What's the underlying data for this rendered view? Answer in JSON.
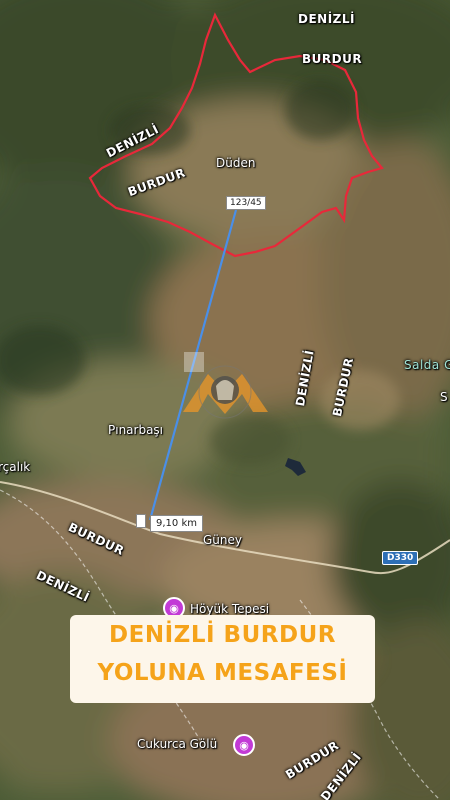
{
  "map": {
    "labels": {
      "denizli_top": "DENİZLİ",
      "burdur_top": "BURDUR",
      "denizli_left": "DENİZLİ",
      "burdur_left": "BURDUR",
      "duden": "Düden",
      "denizli_mid": "DENİZLİ",
      "burdur_mid": "BURDUR",
      "salda": "Salda G",
      "salda_s": "S",
      "pinarbasi": "Pınarbaşı",
      "calik": "rçalık",
      "burdur_lower": "BURDUR",
      "denizli_lower": "DENİZLİ",
      "guney": "Güney",
      "hoyuk": "Höyük Tepesi",
      "cukurca": "Cukurca Gölü",
      "burdur_bottom": "BURDUR",
      "denizli_bottom": "DENİZLİ"
    },
    "parcel_label": "123/45",
    "distance_label": "9,10 km",
    "road_shield": "D330",
    "colors": {
      "boundary": "#e8283a",
      "measure_line": "#4a8fe8",
      "banner_text": "#f5a31a"
    }
  },
  "banner": {
    "line1": "DENİZLİ BURDUR",
    "line2": "YOLUNA MESAFESİ"
  }
}
